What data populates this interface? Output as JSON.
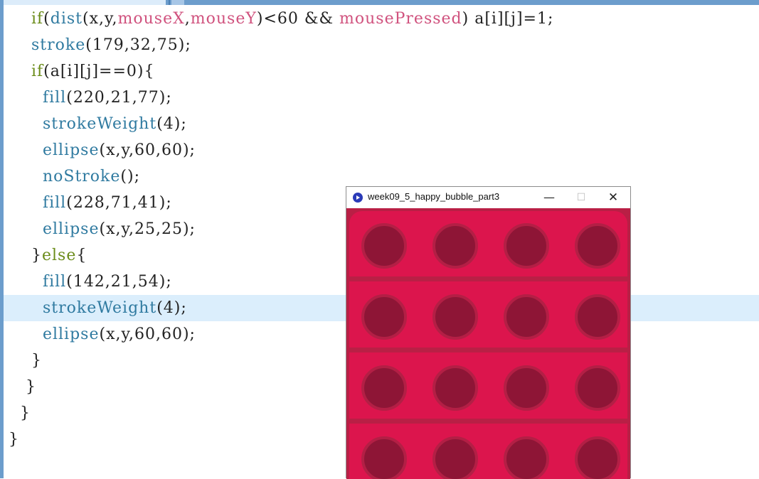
{
  "editor": {
    "lines": [
      [
        {
          "t": "    "
        },
        {
          "t": "if",
          "c": "kw"
        },
        {
          "t": "("
        },
        {
          "t": "dist",
          "c": "fn"
        },
        {
          "t": "(x,y,"
        },
        {
          "t": "mouseX",
          "c": "var"
        },
        {
          "t": ","
        },
        {
          "t": "mouseY",
          "c": "var"
        },
        {
          "t": ")<60 && "
        },
        {
          "t": "mousePressed",
          "c": "var"
        },
        {
          "t": ") a[i][j]=1;"
        }
      ],
      [
        {
          "t": "    "
        },
        {
          "t": "stroke",
          "c": "fn"
        },
        {
          "t": "(179,32,75);"
        }
      ],
      [
        {
          "t": "    "
        },
        {
          "t": "if",
          "c": "kw"
        },
        {
          "t": "(a[i][j]==0){"
        }
      ],
      [
        {
          "t": "      "
        },
        {
          "t": "fill",
          "c": "fn"
        },
        {
          "t": "(220,21,77);"
        }
      ],
      [
        {
          "t": "      "
        },
        {
          "t": "strokeWeight",
          "c": "fn"
        },
        {
          "t": "(4);"
        }
      ],
      [
        {
          "t": "      "
        },
        {
          "t": "ellipse",
          "c": "fn"
        },
        {
          "t": "(x,y,60,60);"
        }
      ],
      [
        {
          "t": "      "
        },
        {
          "t": "noStroke",
          "c": "fn"
        },
        {
          "t": "();"
        }
      ],
      [
        {
          "t": "      "
        },
        {
          "t": "fill",
          "c": "fn"
        },
        {
          "t": "(228,71,41);"
        }
      ],
      [
        {
          "t": "      "
        },
        {
          "t": "ellipse",
          "c": "fn"
        },
        {
          "t": "(x,y,25,25);"
        }
      ],
      [
        {
          "t": "    }"
        },
        {
          "t": "else",
          "c": "kw"
        },
        {
          "t": "{"
        }
      ],
      [
        {
          "t": "      "
        },
        {
          "t": "fill",
          "c": "fn"
        },
        {
          "t": "(142,21,54);"
        }
      ],
      [
        {
          "t": "      "
        },
        {
          "t": "strokeWeight",
          "c": "fn"
        },
        {
          "t": "(4);"
        }
      ],
      [
        {
          "t": "      "
        },
        {
          "t": "ellipse",
          "c": "fn"
        },
        {
          "t": "(x,y,60,60);"
        }
      ],
      [
        {
          "t": "    }"
        }
      ],
      [
        {
          "t": "   }"
        }
      ],
      [
        {
          "t": "  }"
        }
      ],
      [
        {
          "t": "}"
        }
      ]
    ],
    "highlighted_line": 12
  },
  "sketch": {
    "title": "week09_5_happy_bubble_part3",
    "minimize_glyph": "—",
    "maximize_glyph": "☐",
    "close_glyph": "✕",
    "colors": {
      "background": "#b91f45",
      "panel": "#dc154d",
      "bubble_fill": "#8e1536",
      "bubble_stroke": "#b31f45"
    },
    "grid": {
      "rows": 4,
      "cols": 4
    }
  }
}
